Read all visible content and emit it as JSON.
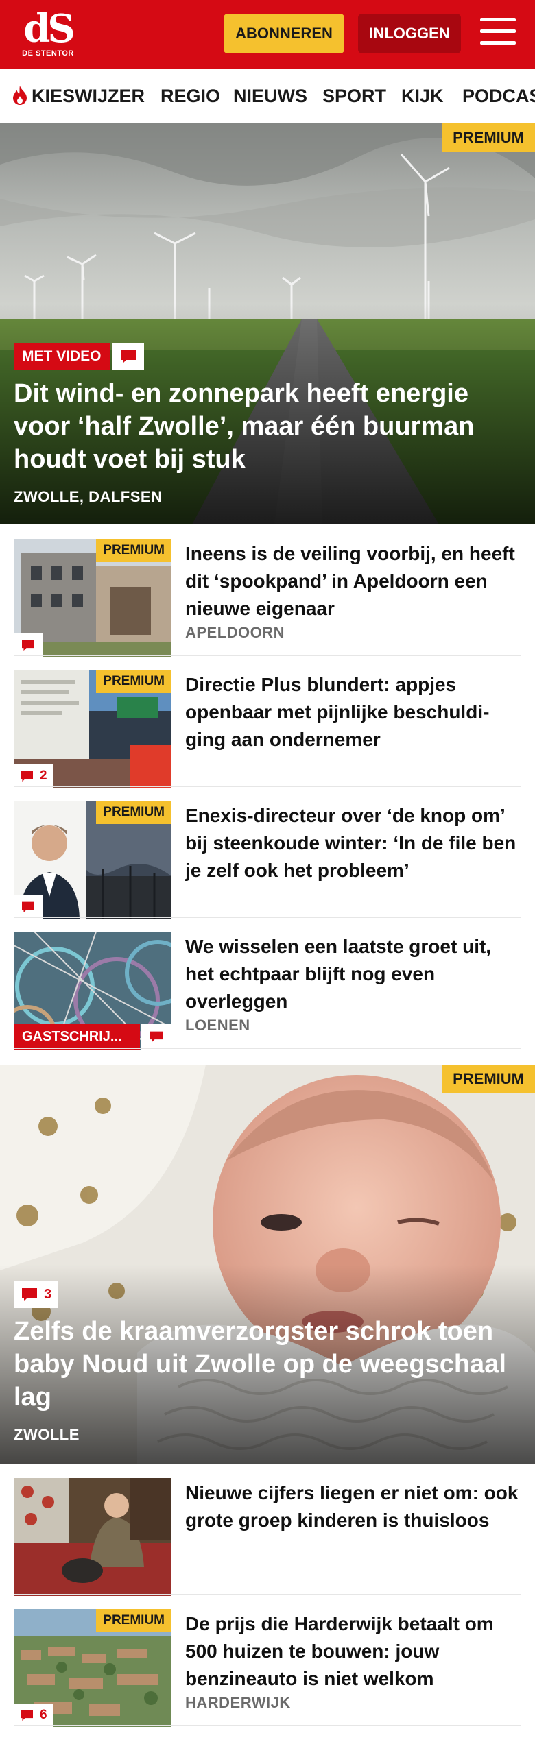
{
  "header": {
    "logo_text": "dS",
    "logo_subtext": "DE STENTOR",
    "subscribe_label": "ABONNEREN",
    "login_label": "INLOGGEN",
    "menu_icon": "hamburger-menu-icon",
    "brand_red": "#d50a14",
    "premium_yellow": "#f5c12e"
  },
  "nav": {
    "items": [
      "KIESWIJZER",
      "REGIO",
      "NIEUWS",
      "SPORT",
      "KIJK",
      "PODCAST"
    ]
  },
  "hero1": {
    "premium_label": "PREMIUM",
    "badge_label": "MET VIDEO",
    "title": "Dit wind- en zonnepark heeft energie voor ‘half Zwolle’, maar één buurman houdt voet bij stuk",
    "location": "ZWOLLE, DALFSEN"
  },
  "articles": [
    {
      "premium": "PREMIUM",
      "title": "Ineens is de veiling voorbij, en heeft dit ‘spookpand’ in Apeldoorn een nieuwe eigenaar",
      "location": "APELDOORN",
      "comments": ""
    },
    {
      "premium": "PREMIUM",
      "title": "Directie Plus blundert: appjes openbaar met pijnlijke beschuldi­ging aan ondernemer",
      "location": "",
      "comments": "2"
    },
    {
      "premium": "PREMIUM",
      "title": "Enexis-directeur over ‘de knop om’ bij steenkoude winter: ‘In de file ben je zelf ook het probleem’",
      "location": "",
      "comments": ""
    },
    {
      "premium": "",
      "title": "We wisselen een laatste groet uit, het echtpaar blijft nog even overleggen",
      "location": "LOENEN",
      "comments": "",
      "guest_label": "GASTSCHRIJ..."
    }
  ],
  "hero2": {
    "premium_label": "PREMIUM",
    "comments": "3",
    "title": "Zelfs de kraamverzorgster schrok toen baby Noud uit Zwolle op de weegschaal lag",
    "location": "ZWOLLE"
  },
  "articles2": [
    {
      "premium": "",
      "title": "Nieuwe cijfers liegen er niet om: ook grote groep kinderen is thuisloos",
      "location": "",
      "comments": ""
    },
    {
      "premium": "PREMIUM",
      "title": "De prijs die Harderwijk betaalt om 500 huizen te bouwen: jouw benzineauto is niet welkom",
      "location": "HARDERWIJK",
      "comments": "6"
    }
  ]
}
